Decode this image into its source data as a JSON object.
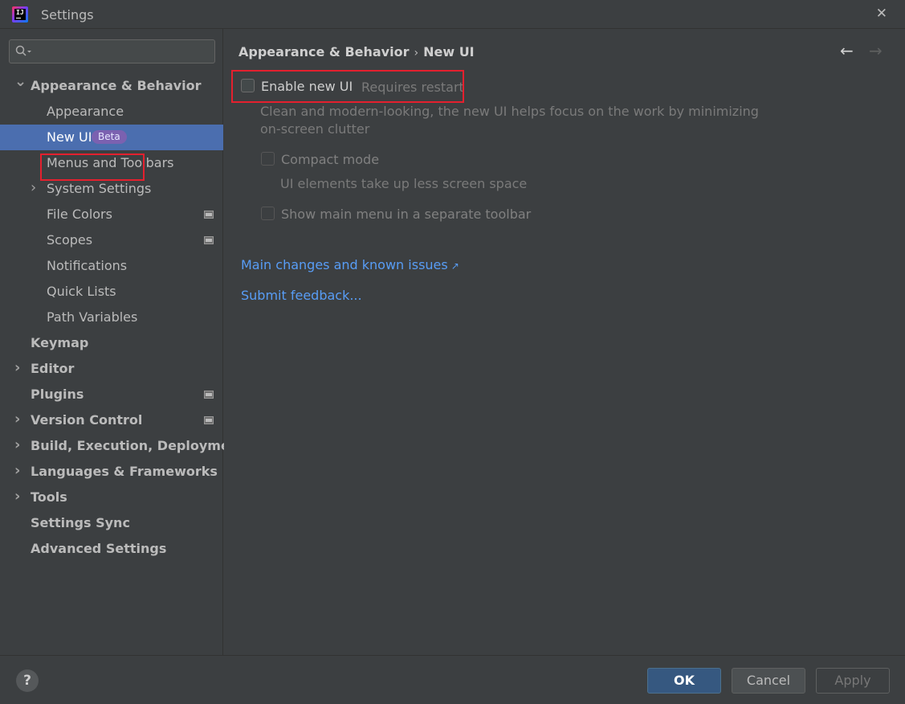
{
  "window": {
    "title": "Settings",
    "close_label": "✕"
  },
  "sidebar": {
    "search": {
      "value": ""
    },
    "items": [
      {
        "label": "Appearance & Behavior",
        "level": 0,
        "expander": "down",
        "bold": true
      },
      {
        "label": "Appearance",
        "level": 1
      },
      {
        "label": "New UI",
        "level": 1,
        "selected": true,
        "badge": "Beta"
      },
      {
        "label": "Menus and Toolbars",
        "level": 1
      },
      {
        "label": "System Settings",
        "level": 1,
        "expander": "right"
      },
      {
        "label": "File Colors",
        "level": 1,
        "project_icon": true
      },
      {
        "label": "Scopes",
        "level": 1,
        "project_icon": true
      },
      {
        "label": "Notifications",
        "level": 1
      },
      {
        "label": "Quick Lists",
        "level": 1
      },
      {
        "label": "Path Variables",
        "level": 1
      },
      {
        "label": "Keymap",
        "level": 0,
        "bold": true
      },
      {
        "label": "Editor",
        "level": 0,
        "expander": "right",
        "bold": true
      },
      {
        "label": "Plugins",
        "level": 0,
        "bold": true,
        "project_icon": true
      },
      {
        "label": "Version Control",
        "level": 0,
        "expander": "right",
        "bold": true,
        "project_icon": true
      },
      {
        "label": "Build, Execution, Deployment",
        "level": 0,
        "expander": "right",
        "bold": true
      },
      {
        "label": "Languages & Frameworks",
        "level": 0,
        "expander": "right",
        "bold": true
      },
      {
        "label": "Tools",
        "level": 0,
        "expander": "right",
        "bold": true
      },
      {
        "label": "Settings Sync",
        "level": 0,
        "bold": true
      },
      {
        "label": "Advanced Settings",
        "level": 0,
        "bold": true
      }
    ]
  },
  "content": {
    "breadcrumb": {
      "parent": "Appearance & Behavior",
      "separator": "›",
      "current": "New UI"
    },
    "nav": {
      "back": "←",
      "forward": "→"
    },
    "enable_new_ui": {
      "label": "Enable new UI",
      "checked": false,
      "note": "Requires restart"
    },
    "description_line1": "Clean and modern-looking, the new UI helps focus on the work by minimizing",
    "description_line2": "on-screen clutter",
    "compact_mode": {
      "label": "Compact mode",
      "checked": false,
      "hint": "UI elements take up less screen space"
    },
    "separate_toolbar": {
      "label": "Show main menu in a separate toolbar",
      "checked": false
    },
    "link_changes": "Main changes and known issues",
    "link_changes_icon": "↗",
    "link_feedback": "Submit feedback..."
  },
  "footer": {
    "help": "?",
    "ok": "OK",
    "cancel": "Cancel",
    "apply": "Apply"
  },
  "colors": {
    "selection": "#4b6eaf",
    "link": "#589df6",
    "highlight": "#e4202e",
    "badge": "#7b61b0"
  }
}
